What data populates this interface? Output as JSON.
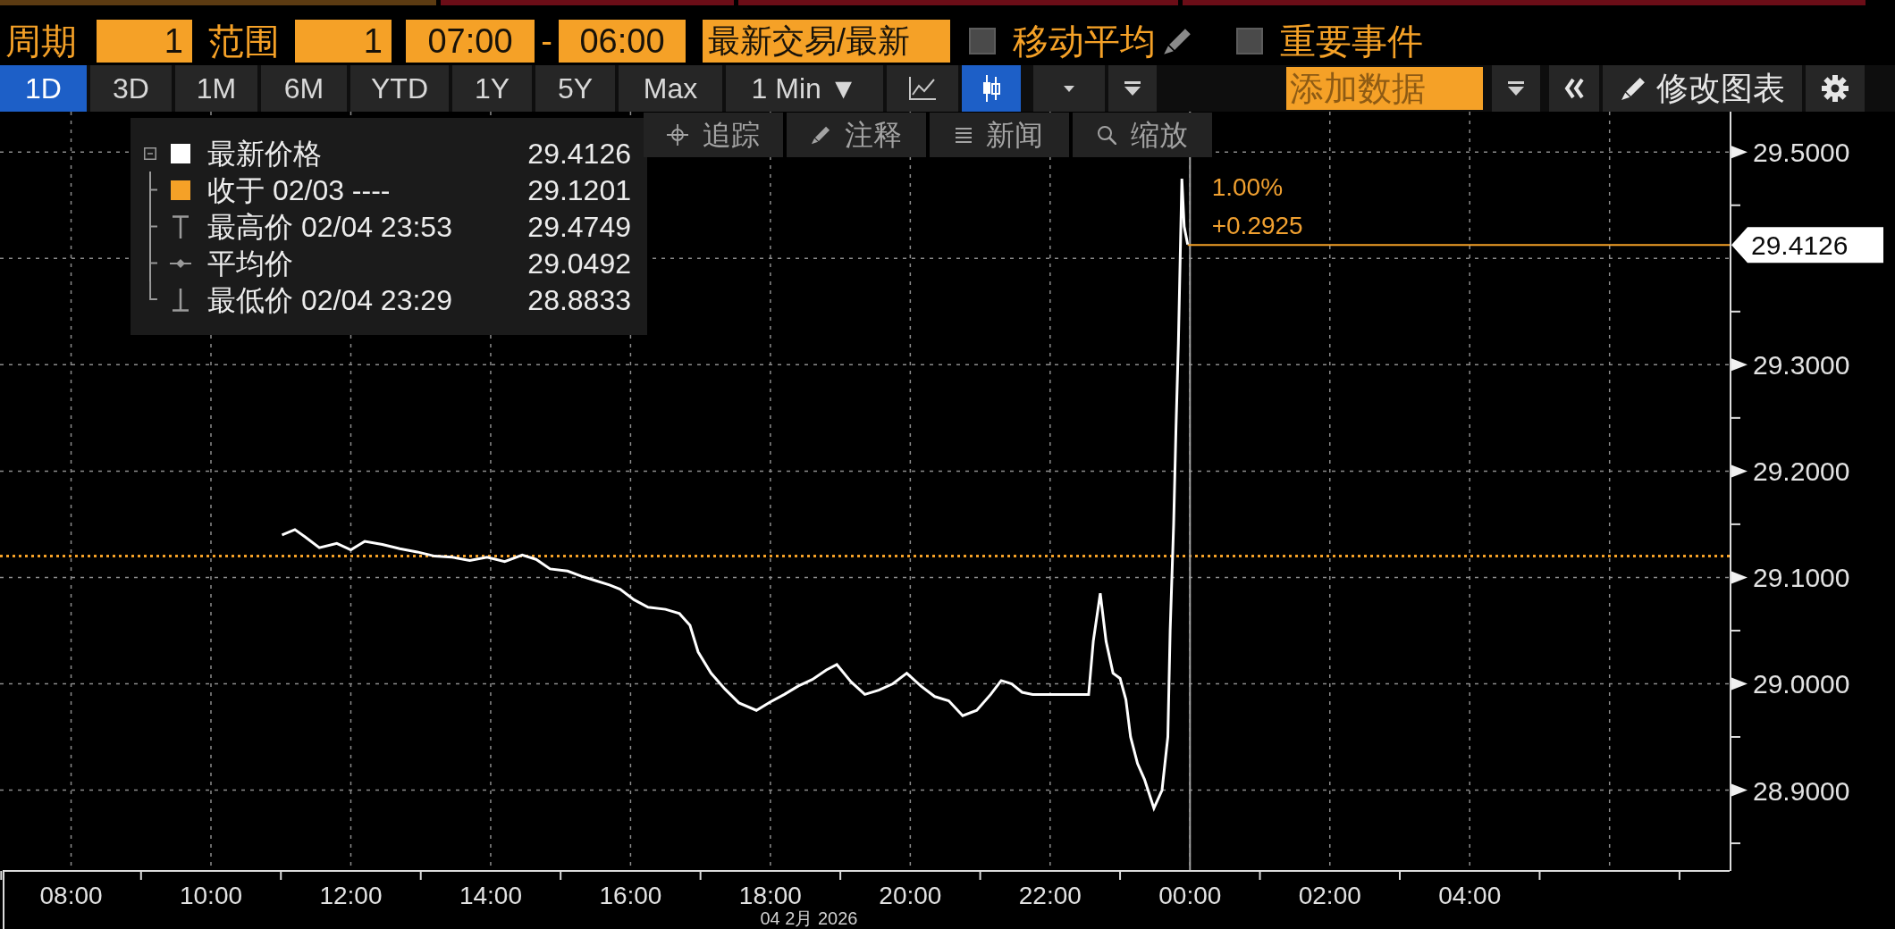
{
  "tab_strip": [
    {
      "color": "#5c3b12"
    },
    {
      "color": "#6b0d17"
    },
    {
      "color": "#6b0d17"
    },
    {
      "color": "#6b0d17"
    }
  ],
  "controls": {
    "period": {
      "label": "周期",
      "value": "1"
    },
    "range": {
      "label": "范围",
      "value": "1"
    },
    "start_time": "07:00",
    "separator": "-",
    "end_time": "06:00",
    "price_source": "最新交易/最新",
    "toggles": [
      {
        "label": "移动平均",
        "checked": false,
        "has_edit": true
      },
      {
        "label": "重要事件",
        "checked": false,
        "has_edit": false
      }
    ]
  },
  "toolbar": {
    "ranges": [
      {
        "label": "1D",
        "selected": true
      },
      {
        "label": "3D",
        "selected": false
      },
      {
        "label": "1M",
        "selected": false
      },
      {
        "label": "6M",
        "selected": false
      },
      {
        "label": "YTD",
        "selected": false
      },
      {
        "label": "1Y",
        "selected": false
      },
      {
        "label": "5Y",
        "selected": false
      },
      {
        "label": "Max",
        "selected": false
      }
    ],
    "interval": "1 Min ▼",
    "chart_types": [
      {
        "kind": "line",
        "selected": false
      },
      {
        "kind": "candle",
        "selected": true
      }
    ],
    "add_data": {
      "placeholder": "添加数据"
    },
    "edit_chart": {
      "label": "修改图表"
    }
  },
  "chart": {
    "legend": {
      "expanded": true,
      "items": [
        {
          "kind": "series",
          "value": "29.4126"
        },
        {
          "kind": "close",
          "label": "收于 02/03 ----",
          "value": "29.1201",
          "color": "#f5a127"
        },
        {
          "kind": "high",
          "label": "最高价 02/04 23:53",
          "value": "29.4749"
        },
        {
          "kind": "average",
          "label": "平均价",
          "value": "29.0492"
        },
        {
          "kind": "low",
          "label": "最低价 02/04 23:29",
          "value": "28.8833"
        }
      ]
    },
    "tools": [
      {
        "kind": "crosshair",
        "label": "追踪"
      },
      {
        "kind": "annotate",
        "label": "注释"
      },
      {
        "kind": "news",
        "label": "新闻"
      },
      {
        "kind": "zoom",
        "label": "缩放"
      }
    ],
    "chart_data": {
      "type": "line",
      "xlabel": "04 2月 2026",
      "grid": true,
      "x": [
        "2026-02-04T11:01",
        "2026-02-04T11:12",
        "2026-02-04T11:21",
        "2026-02-04T11:33",
        "2026-02-04T11:48",
        "2026-02-04T12:00",
        "2026-02-04T12:12",
        "2026-02-04T12:27",
        "2026-02-04T12:42",
        "2026-02-04T12:57",
        "2026-02-04T13:12",
        "2026-02-04T13:27",
        "2026-02-04T13:42",
        "2026-02-04T13:57",
        "2026-02-04T14:12",
        "2026-02-04T14:27",
        "2026-02-04T14:39",
        "2026-02-04T14:51",
        "2026-02-04T15:06",
        "2026-02-04T15:18",
        "2026-02-04T15:30",
        "2026-02-04T15:42",
        "2026-02-04T15:51",
        "2026-02-04T16:03",
        "2026-02-04T16:15",
        "2026-02-04T16:30",
        "2026-02-04T16:42",
        "2026-02-04T16:51",
        "2026-02-04T16:58",
        "2026-02-04T17:09",
        "2026-02-04T17:21",
        "2026-02-04T17:33",
        "2026-02-04T17:48",
        "2026-02-04T18:00",
        "2026-02-04T18:12",
        "2026-02-04T18:24",
        "2026-02-04T18:36",
        "2026-02-04T18:48",
        "2026-02-04T18:57",
        "2026-02-04T19:09",
        "2026-02-04T19:21",
        "2026-02-04T19:33",
        "2026-02-04T19:45",
        "2026-02-04T19:57",
        "2026-02-04T20:09",
        "2026-02-04T20:21",
        "2026-02-04T20:33",
        "2026-02-04T20:45",
        "2026-02-04T20:57",
        "2026-02-04T21:09",
        "2026-02-04T21:18",
        "2026-02-04T21:27",
        "2026-02-04T21:36",
        "2026-02-04T21:45",
        "2026-02-04T22:33",
        "2026-02-04T22:37",
        "2026-02-04T22:43",
        "2026-02-04T22:48",
        "2026-02-04T22:54",
        "2026-02-04T23:00",
        "2026-02-04T23:05",
        "2026-02-04T23:09",
        "2026-02-04T23:15",
        "2026-02-04T23:21",
        "2026-02-04T23:29",
        "2026-02-04T23:36",
        "2026-02-04T23:41",
        "2026-02-04T23:43",
        "2026-02-04T23:46",
        "2026-02-04T23:48",
        "2026-02-04T23:50",
        "2026-02-04T23:53",
        "2026-02-04T23:55",
        "2026-02-04T23:58"
      ],
      "series": [
        {
          "name": "最新价格",
          "color": "#ffffff",
          "values": [
            29.14,
            29.145,
            29.138,
            29.128,
            29.132,
            29.126,
            29.134,
            29.131,
            29.127,
            29.124,
            29.12,
            29.119,
            29.116,
            29.119,
            29.115,
            29.121,
            29.117,
            29.108,
            29.106,
            29.101,
            29.097,
            29.093,
            29.089,
            29.079,
            29.072,
            29.07,
            29.066,
            29.055,
            29.03,
            29.01,
            28.995,
            28.982,
            28.975,
            28.983,
            28.99,
            28.998,
            29.004,
            29.013,
            29.018,
            29.002,
            28.99,
            28.994,
            29.0,
            29.01,
            28.998,
            28.988,
            28.984,
            28.97,
            28.975,
            28.99,
            29.003,
            29.0,
            28.992,
            28.99,
            28.99,
            29.04,
            29.085,
            29.04,
            29.01,
            29.005,
            28.985,
            28.95,
            28.925,
            28.91,
            28.883,
            28.9,
            28.95,
            29.05,
            29.15,
            29.24,
            29.32,
            29.475,
            29.43,
            29.413
          ]
        }
      ],
      "xlim": [
        "2026-02-04T06:59",
        "2026-02-05T07:43"
      ],
      "ylim": [
        28.824,
        29.538
      ],
      "xticks": [
        {
          "value": "2026-02-04T08:00",
          "label": "08:00"
        },
        {
          "value": "2026-02-04T10:00",
          "label": "10:00"
        },
        {
          "value": "2026-02-04T12:00",
          "label": "12:00"
        },
        {
          "value": "2026-02-04T14:00",
          "label": "14:00"
        },
        {
          "value": "2026-02-04T16:00",
          "label": "16:00"
        },
        {
          "value": "2026-02-04T18:00",
          "label": "18:00"
        },
        {
          "value": "2026-02-04T20:00",
          "label": "20:00"
        },
        {
          "value": "2026-02-04T22:00",
          "label": "22:00"
        },
        {
          "value": "2026-02-05T00:00",
          "label": "00:00"
        },
        {
          "value": "2026-02-05T02:00",
          "label": "02:00"
        },
        {
          "value": "2026-02-05T04:00",
          "label": "04:00"
        }
      ],
      "yticks": [
        {
          "value": 28.9,
          "label": "28.9000"
        },
        {
          "value": 29.0,
          "label": "29.0000"
        },
        {
          "value": 29.1,
          "label": "29.1000"
        },
        {
          "value": 29.2,
          "label": "29.2000"
        },
        {
          "value": 29.3,
          "label": "29.3000"
        },
        {
          "value": 29.5,
          "label": "29.5000"
        }
      ],
      "ref_lines": [
        {
          "axis": "y",
          "value": 29.1201,
          "color": "#f5a127"
        },
        {
          "axis": "x",
          "value": "2026-02-05T00:00",
          "color": "#a0a0a0"
        },
        {
          "axis": "y",
          "value": 29.4126,
          "label": "29.4126",
          "color": "#f5a127"
        }
      ],
      "annotations": [
        {
          "text": "1.00%"
        },
        {
          "text": "+0.2925"
        }
      ]
    }
  }
}
